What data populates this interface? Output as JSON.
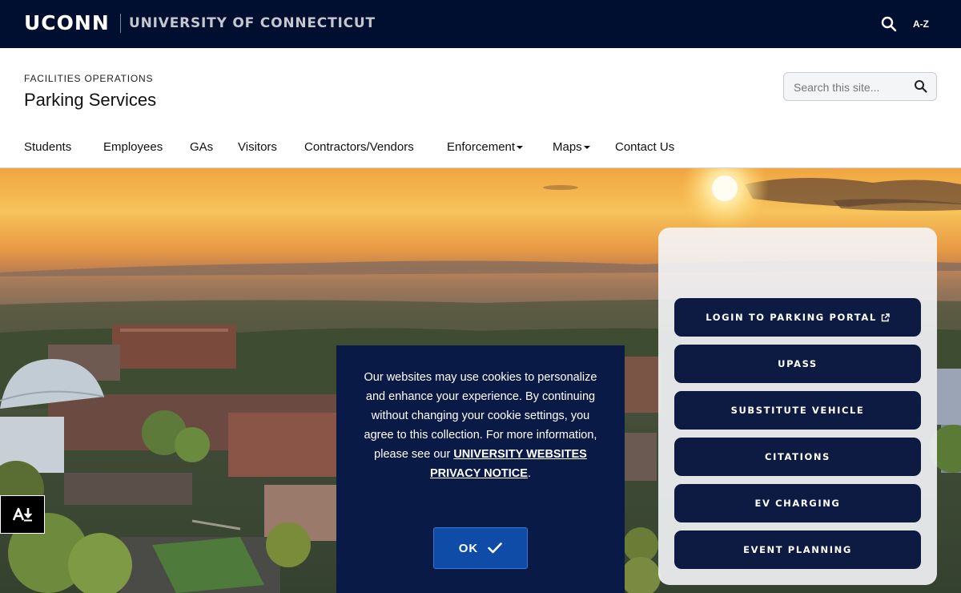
{
  "banner": {
    "wordmark": "UCONN",
    "university": "UNIVERSITY OF CONNECTICUT",
    "search_icon": "search-icon",
    "az_label": "A-Z"
  },
  "header": {
    "department": "FACILITIES OPERATIONS",
    "title": "Parking Services",
    "search_placeholder": "Search this site..."
  },
  "nav": {
    "items": [
      {
        "label": "Students"
      },
      {
        "label": "Employees"
      },
      {
        "label": "GAs"
      },
      {
        "label": "Visitors"
      },
      {
        "label": "Contractors/Vendors"
      },
      {
        "label": "Enforcement"
      },
      {
        "label": "Maps"
      },
      {
        "label": "Contact Us"
      }
    ]
  },
  "cookie": {
    "text": "Our websites may use cookies to personalize and enhance your experience. By continuing without changing your cookie settings, you agree to this collection. For more information, please see our",
    "link": "UNIVERSITY WEBSITES PRIVACY NOTICE",
    "end": ".",
    "ok_label": "OK"
  },
  "quick_links": [
    {
      "label": "LOGIN TO PARKING PORTAL",
      "icon": "external-link-icon"
    },
    {
      "label": "UPASS"
    },
    {
      "label": "SUBSTITUTE VEHICLE"
    },
    {
      "label": "CITATIONS"
    },
    {
      "label": "EV CHARGING"
    },
    {
      "label": "EVENT PLANNING"
    }
  ],
  "colors": {
    "banner_bg": "#000e2f",
    "navy": "#0d1a42",
    "ok_blue": "#0e4ca8"
  }
}
